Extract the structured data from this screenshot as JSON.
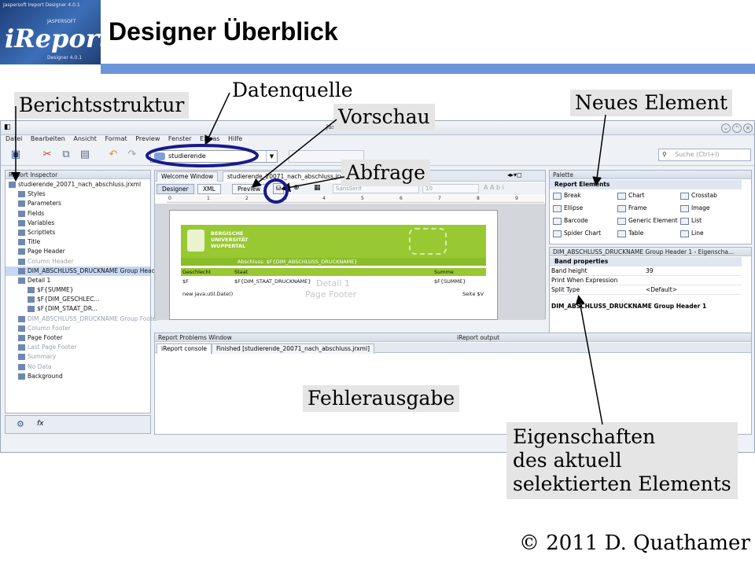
{
  "slide": {
    "title": "Designer Überblick",
    "copyright": "© 2011 D. Quathamer",
    "logo": {
      "brand": "iReport",
      "small_text": "Jaspersoft Ireport Designer 4.0.1",
      "vendor": "JASPERSOFT",
      "version": "Designer 4.0.1"
    }
  },
  "app": {
    "window_title": "Jaspersoft iReport Designer 4.0.1",
    "menu": [
      "Datei",
      "Bearbeiten",
      "Ansicht",
      "Format",
      "Preview",
      "Fenster",
      "Extras",
      "Hilfe"
    ],
    "datasource_value": "studierende",
    "search_placeholder": "Suche (Ctrl+I)"
  },
  "inspector": {
    "title": "Report Inspector",
    "nodes": [
      {
        "label": "studierende_20071_nach_abschluss.jrxml",
        "level": 0,
        "dim": false
      },
      {
        "label": "Styles",
        "level": 1,
        "dim": false
      },
      {
        "label": "Parameters",
        "level": 1,
        "dim": false
      },
      {
        "label": "Fields",
        "level": 1,
        "dim": false
      },
      {
        "label": "Variables",
        "level": 1,
        "dim": false
      },
      {
        "label": "Scriptlets",
        "level": 1,
        "dim": false
      },
      {
        "label": "Title",
        "level": 1,
        "dim": false
      },
      {
        "label": "Page Header",
        "level": 1,
        "dim": false
      },
      {
        "label": "Column Header",
        "level": 1,
        "dim": true
      },
      {
        "label": "DIM_ABSCHLUSS_DRUCKNAME Group Header",
        "level": 1,
        "dim": false,
        "selected": true
      },
      {
        "label": "Detail 1",
        "level": 1,
        "dim": false
      },
      {
        "label": "$F{SUMME}",
        "level": 2,
        "dim": false
      },
      {
        "label": "$F{DIM_GESCHLEC...",
        "level": 2,
        "dim": false
      },
      {
        "label": "$F{DIM_STAAT_DR...",
        "level": 2,
        "dim": false
      },
      {
        "label": "DIM_ABSCHLUSS_DRUCKNAME Group Footer",
        "level": 1,
        "dim": true
      },
      {
        "label": "Column Footer",
        "level": 1,
        "dim": true
      },
      {
        "label": "Page Footer",
        "level": 1,
        "dim": false
      },
      {
        "label": "Last Page Footer",
        "level": 1,
        "dim": true
      },
      {
        "label": "Summary",
        "level": 1,
        "dim": true
      },
      {
        "label": "No Data",
        "level": 1,
        "dim": true
      },
      {
        "label": "Background",
        "level": 1,
        "dim": false
      }
    ]
  },
  "editor": {
    "tabs": [
      "Welcome Window",
      "studierende_20071_nach_abschluss.jrxml"
    ],
    "views": [
      "Designer",
      "XML",
      "Preview"
    ],
    "font_combo": "SansSerif",
    "size_combo": "10",
    "ruler": [
      "0",
      "1",
      "2",
      "3",
      "4",
      "5",
      "6",
      "7",
      "8",
      "9"
    ],
    "report": {
      "university": [
        "BERGISCHE",
        "UNIVERSITÄT",
        "WUPPERTAL"
      ],
      "group_expr": "Abschluss: $F{DIM_ABSCHLUSS_DRUCKNAME}",
      "headers": [
        "Geschlecht",
        "Staat",
        "Summe"
      ],
      "fields": [
        "$F",
        "$F{DIM_STAAT_DRUCKNAME}",
        "$F{SUMME}"
      ],
      "detail_label": "Detail 1",
      "footer_label": "Page Footer",
      "date_expr": "new java.util.Date()",
      "page_expr": "Seite $V"
    }
  },
  "palette": {
    "title": "Palette",
    "section": "Report Elements",
    "items": [
      "Break",
      "Chart",
      "Crosstab",
      "Ellipse",
      "Frame",
      "Image",
      "Barcode",
      "Generic Element",
      "List",
      "Spider Chart",
      "Table",
      "Line"
    ]
  },
  "properties": {
    "title": "DIM_ABSCHLUSS_DRUCKNAME Group Header 1 - Eigenscha...",
    "section": "Band properties",
    "rows": [
      {
        "name": "Band height",
        "value": "39"
      },
      {
        "name": "Print When Expression",
        "value": ""
      },
      {
        "name": "Split Type",
        "value": "<Default>"
      }
    ],
    "description": "DIM_ABSCHLUSS_DRUCKNAME Group Header 1"
  },
  "output": {
    "title": "Report Problems Window",
    "title_right": "iReport output",
    "tabs": [
      "iReport console",
      "Finished [studierende_20071_nach_abschluss.jrxml]"
    ]
  },
  "annotations": {
    "berichtsstruktur": "Berichtsstruktur",
    "datenquelle": "Datenquelle",
    "vorschau": "Vorschau",
    "abfrage": "Abfrage",
    "neues_element": "Neues Element",
    "fehlerausgabe": "Fehlerausgabe",
    "eigenschaften": [
      "Eigenschaften",
      "des aktuell",
      "selektierten Elements"
    ]
  },
  "colors": {
    "accent_bar": "#6b95d8",
    "report_green": "#98c832",
    "annotation_ring": "#1a1a8c"
  }
}
